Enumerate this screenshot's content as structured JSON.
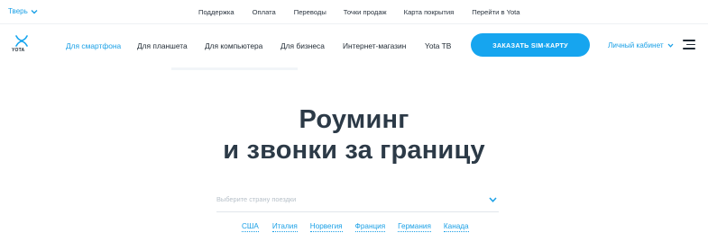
{
  "topbar": {
    "city": "Тверь",
    "links": [
      "Поддержка",
      "Оплата",
      "Переводы",
      "Точки продаж",
      "Карта покрытия",
      "Перейти в Yota"
    ]
  },
  "nav": {
    "logo_text": "YOTA",
    "links": [
      "Для смартфона",
      "Для планшета",
      "Для компьютера",
      "Для бизнеса",
      "Интернет-магазин",
      "Yota TB"
    ],
    "active_index": 0,
    "order_sim_label": "ЗАКАЗАТЬ SIM-КАРТУ",
    "cabinet_label": "Личный кабинет"
  },
  "hero": {
    "title_line1": "Роуминг",
    "title_line2": "и звонки за границу"
  },
  "country_search": {
    "placeholder": "Выберите страну поездки",
    "value": ""
  },
  "quick_countries": [
    "США",
    "Италия",
    "Норвегия",
    "Франция",
    "Германия",
    "Канада"
  ],
  "colors": {
    "accent": "#16a5ef",
    "link": "#1aa0e6",
    "title": "#2c3a47",
    "text": "#1f2933"
  },
  "icons": {
    "city_chevron": "chevron-down-icon",
    "logo": "yota-logo-icon",
    "cabinet_chevron": "chevron-down-icon",
    "menu": "hamburger-menu-icon",
    "select_chevron": "chevron-down-icon"
  }
}
